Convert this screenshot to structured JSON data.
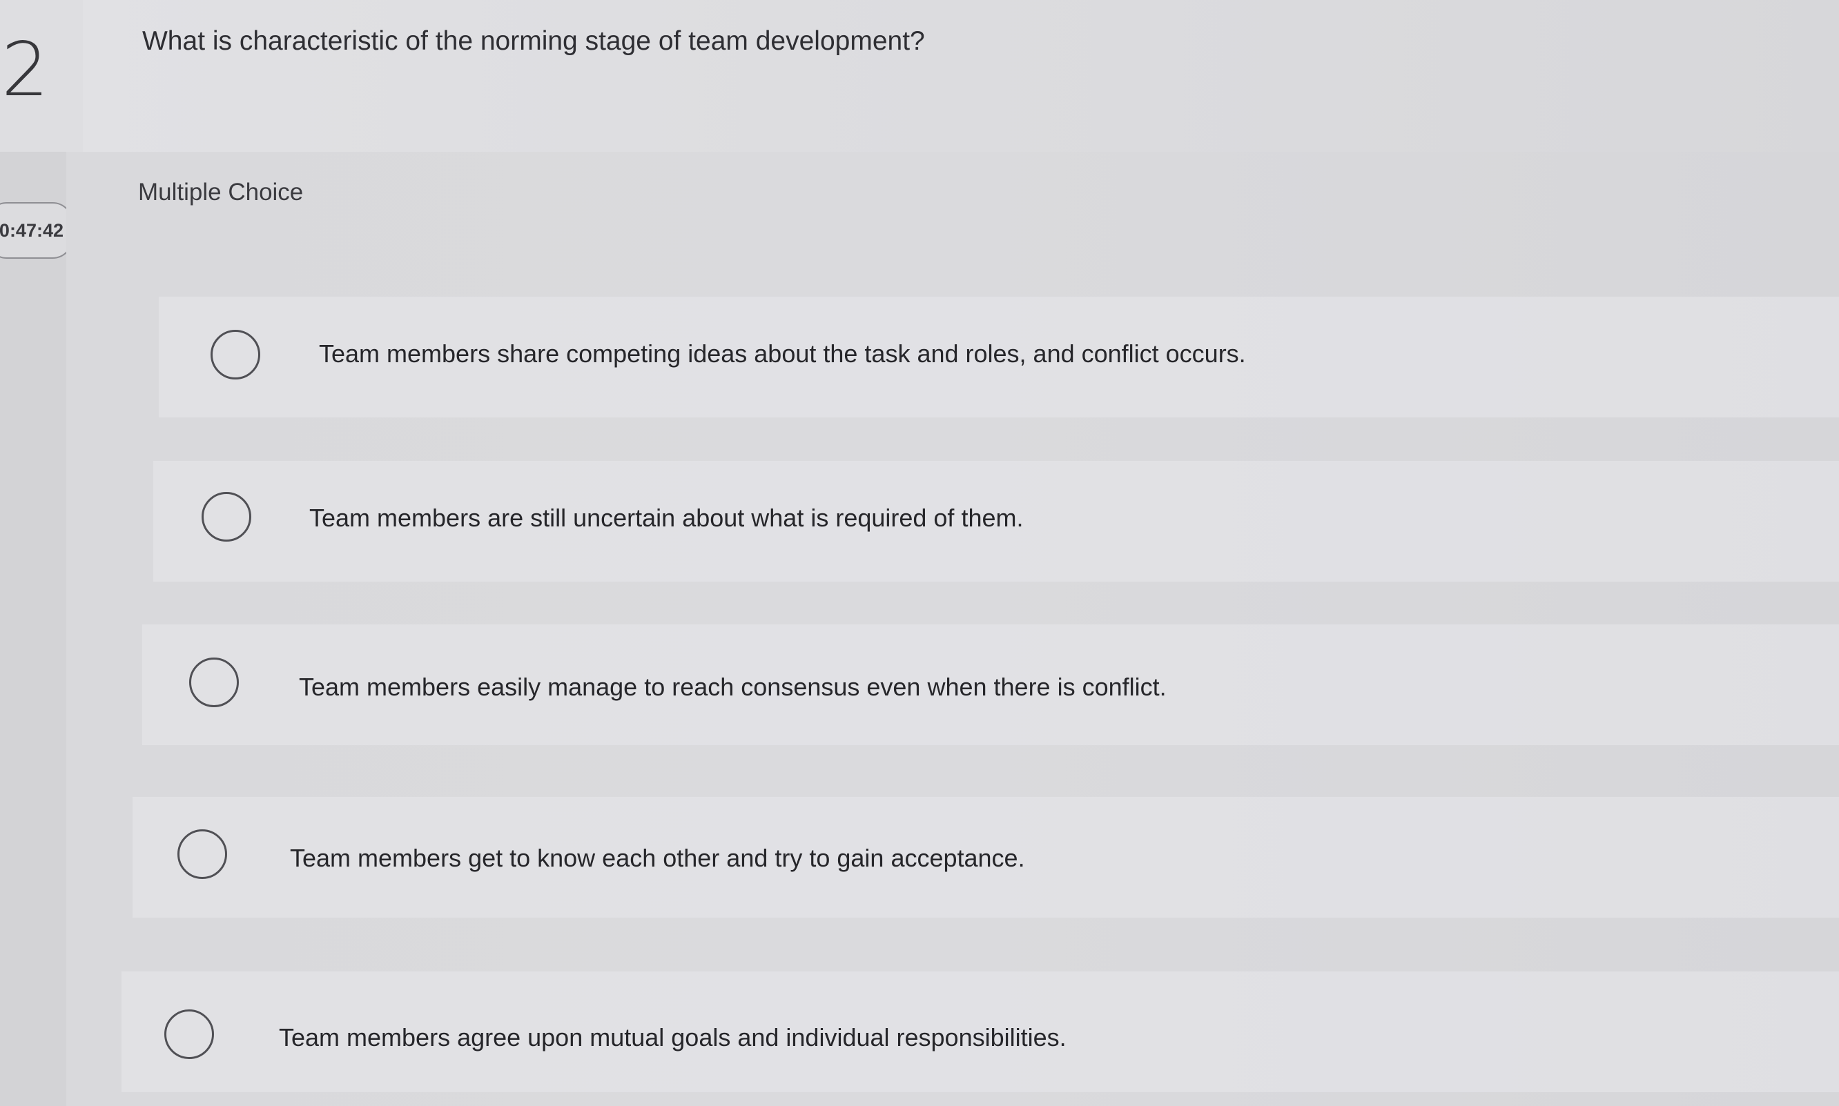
{
  "question": {
    "number": "2",
    "text": "What is characteristic of the norming stage of team development?"
  },
  "timer": {
    "text": "0:47:42"
  },
  "answer_section": {
    "type_label": "Multiple Choice",
    "options": [
      {
        "label": "Team members share competing ideas about the task and roles, and conflict occurs."
      },
      {
        "label": "Team members are still uncertain about what is required of them."
      },
      {
        "label": "Team members easily manage to reach consensus even when there is conflict."
      },
      {
        "label": "Team members get to know each other and try to gain acceptance."
      },
      {
        "label": "Team members agree upon mutual goals and individual responsibilities."
      }
    ]
  }
}
